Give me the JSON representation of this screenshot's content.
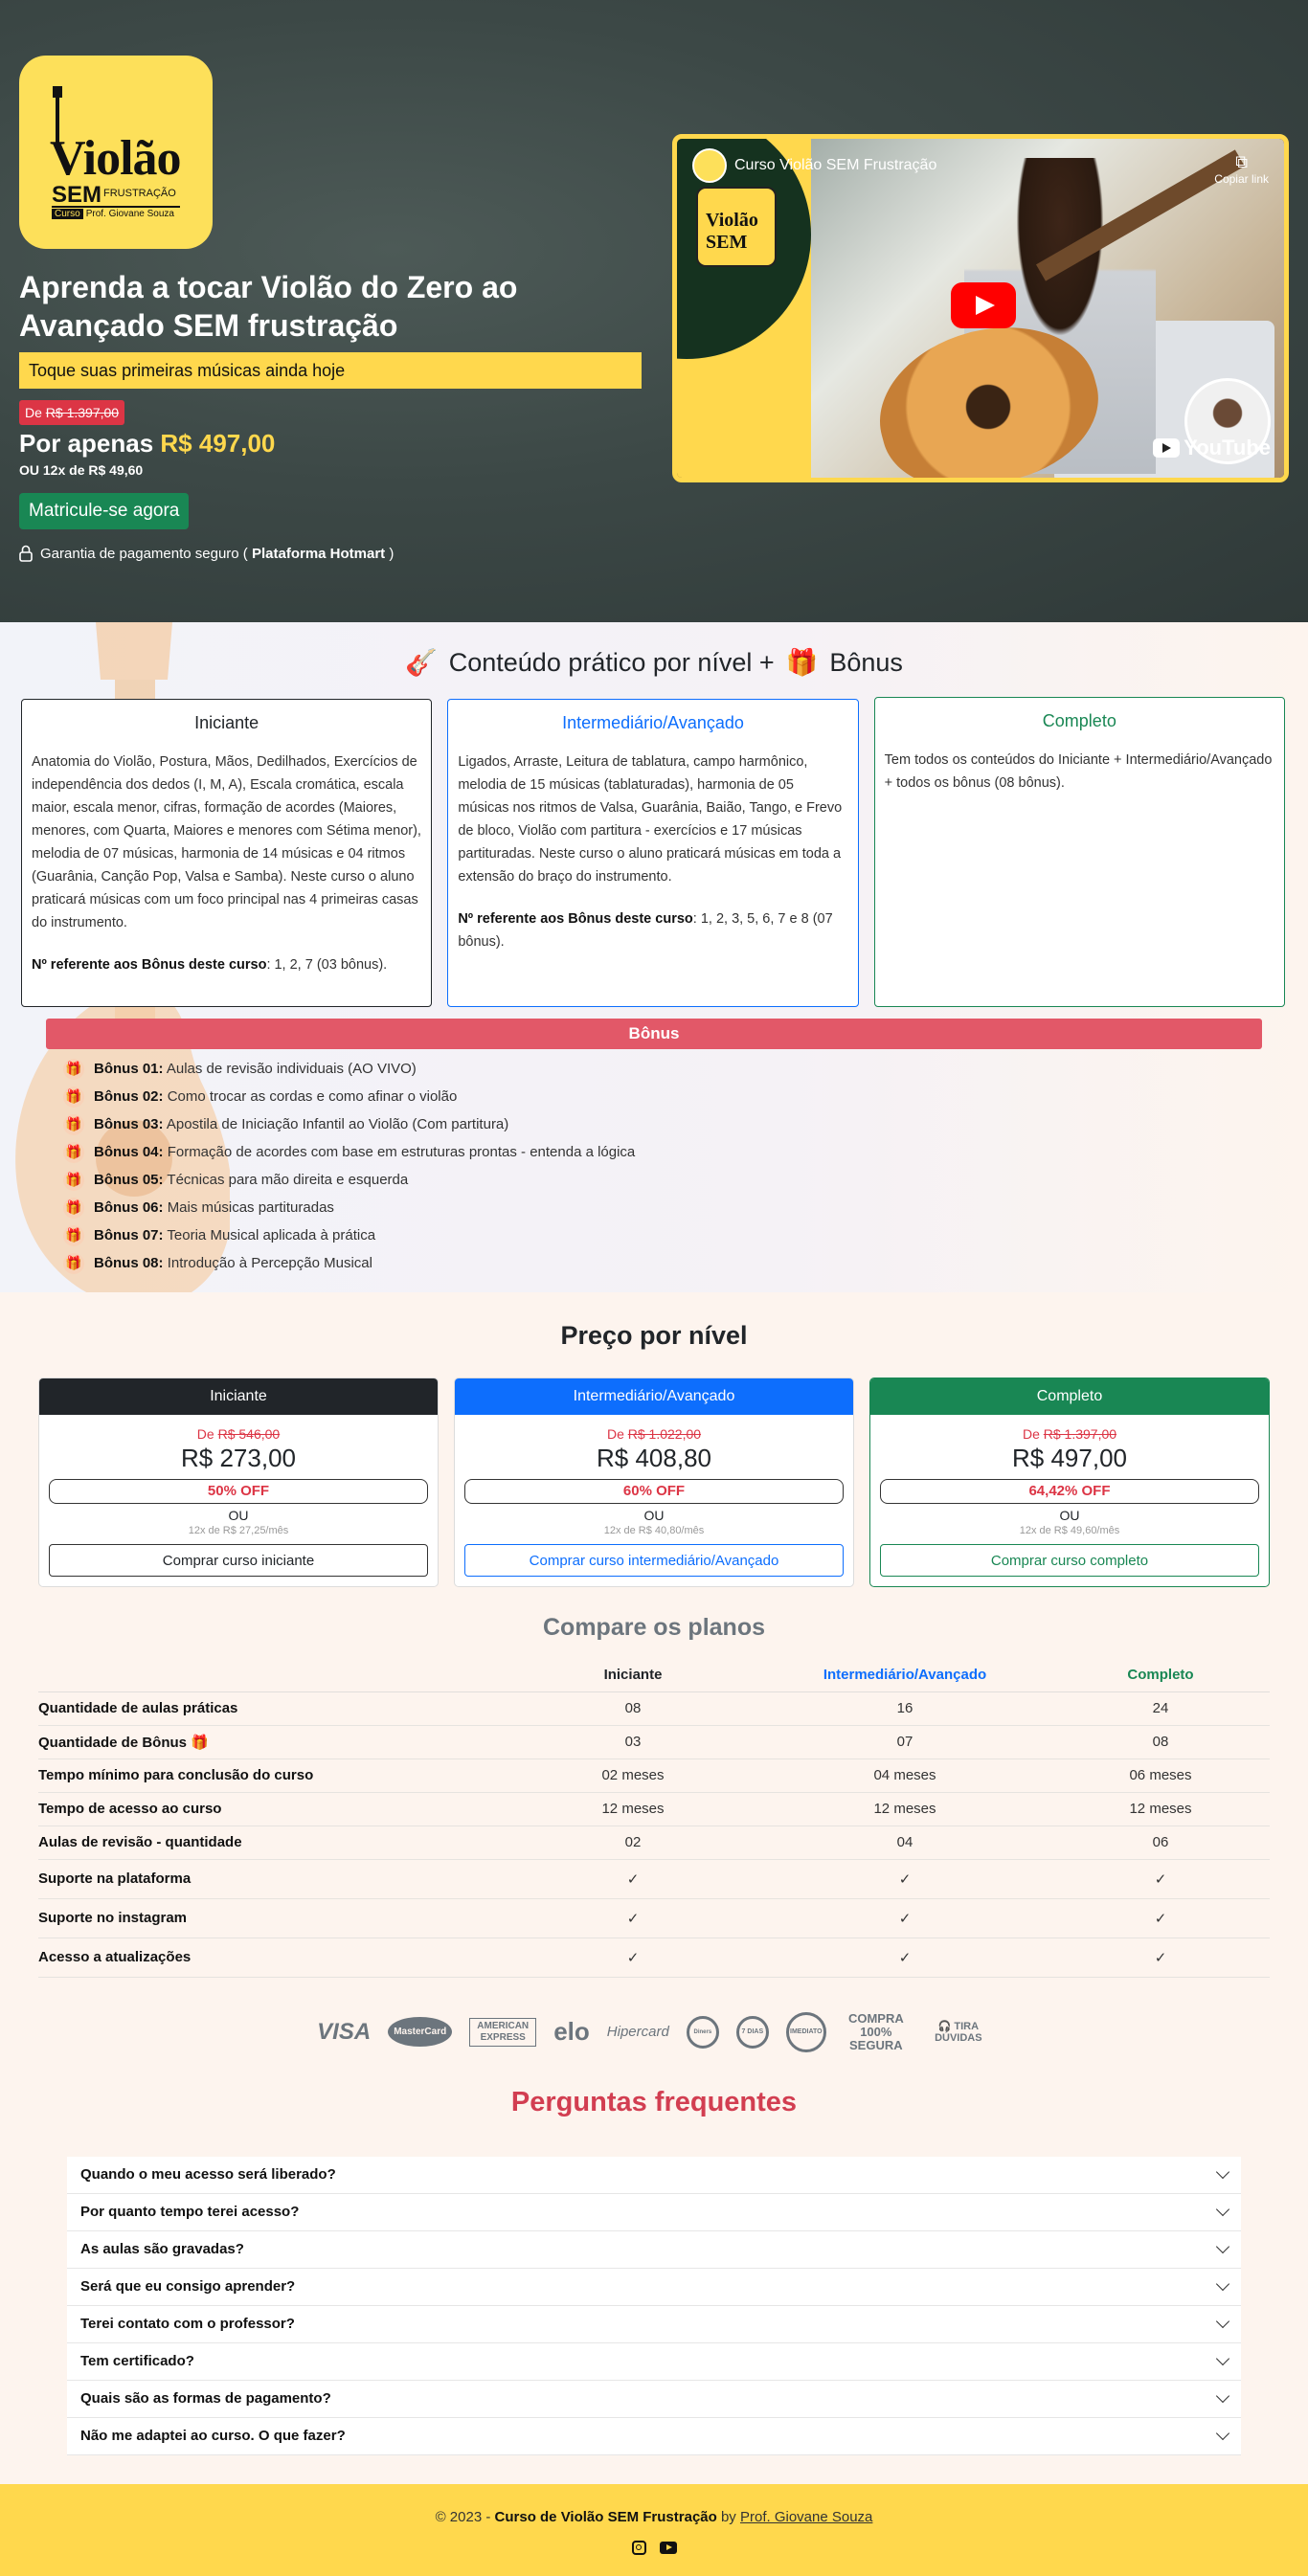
{
  "hero": {
    "logo": {
      "line1": "Violão",
      "line2": "SEM",
      "line3": "FRUSTRAÇÃO",
      "tag": "Curso",
      "author": "Prof. Giovane Souza"
    },
    "headline": "Aprenda a tocar Violão do Zero ao Avançado SEM frustração",
    "subline": "Toque suas primeiras músicas ainda hoje",
    "old_price_prefix": "De",
    "old_price": "R$ 1.397,00",
    "now_prefix": "Por apenas",
    "now_price": "R$ 497,00",
    "installments": "OU 12x de R$ 49,60",
    "enroll_label": "Matricule-se agora",
    "secure_text": "Garantia de pagamento seguro (",
    "secure_platform": "Plataforma Hotmart",
    "secure_end": ")",
    "video": {
      "title": "Curso Violão SEM Frustração",
      "copy_label": "Copiar link",
      "yt_label": "YouTube",
      "mini_logo": "Violão SEM"
    }
  },
  "content": {
    "title": "Conteúdo prático por nível +",
    "title_bonus": "Bônus",
    "levels": [
      {
        "name": "Iniciante",
        "desc": "Anatomia do Violão, Postura, Mãos, Dedilhados, Exercícios de independência dos dedos (I, M, A), Escala cromática, escala maior, escala menor, cifras, formação de acordes (Maiores, menores, com Quarta, Maiores e menores com Sétima menor), melodia de 07 músicas, harmonia de 14 músicas e 04 ritmos (Guarânia, Canção Pop, Valsa e Samba). Neste curso o aluno praticará músicas com um foco principal nas 4 primeiras casas do instrumento.",
        "bonus_label": "Nº referente aos Bônus deste curso",
        "bonus_text": ": 1, 2, 7 (03 bônus)."
      },
      {
        "name": "Intermediário/Avançado",
        "desc": "Ligados, Arraste, Leitura de tablatura, campo harmônico, melodia de 15 músicas (tablaturadas), harmonia de 05 músicas nos ritmos de Valsa, Guarânia, Baião, Tango, e Frevo de bloco, Violão com partitura - exercícios e 17 músicas partituradas. Neste curso o aluno praticará músicas em toda a extensão do braço do instrumento.",
        "bonus_label": "Nº referente aos Bônus deste curso",
        "bonus_text": ": 1, 2, 3, 5, 6, 7 e 8 (07 bônus)."
      },
      {
        "name": "Completo",
        "desc": "Tem todos os conteúdos do Iniciante + Intermediário/Avançado + todos os bônus (08 bônus).",
        "bonus_label": "",
        "bonus_text": ""
      }
    ],
    "bonus_header": "Bônus",
    "bonuses": [
      {
        "label": "Bônus 01:",
        "text": "Aulas de revisão individuais (AO VIVO)"
      },
      {
        "label": "Bônus 02:",
        "text": "Como trocar as cordas e como afinar o violão"
      },
      {
        "label": "Bônus 03:",
        "text": "Apostila de Iniciação Infantil ao Violão (Com partitura)"
      },
      {
        "label": "Bônus 04:",
        "text": "Formação de acordes com base em estruturas prontas - entenda a lógica"
      },
      {
        "label": "Bônus 05:",
        "text": "Técnicas para mão direita e esquerda"
      },
      {
        "label": "Bônus 06:",
        "text": "Mais músicas partituradas"
      },
      {
        "label": "Bônus 07:",
        "text": "Teoria Musical aplicada à prática"
      },
      {
        "label": "Bônus 08:",
        "text": "Introdução à Percepção Musical"
      }
    ]
  },
  "prices": {
    "title": "Preço por nível",
    "cards": [
      {
        "name": "Iniciante",
        "from_prefix": "De",
        "from": "R$ 546,00",
        "price": "R$ 273,00",
        "off": "50% OFF",
        "ou": "OU",
        "inst": "12x de R$ 27,25/mês",
        "buy": "Comprar curso iniciante"
      },
      {
        "name": "Intermediário/Avançado",
        "from_prefix": "De",
        "from": "R$ 1.022,00",
        "price": "R$ 408,80",
        "off": "60% OFF",
        "ou": "OU",
        "inst": "12x de R$ 40,80/mês",
        "buy": "Comprar curso intermediário/Avançado"
      },
      {
        "name": "Completo",
        "from_prefix": "De",
        "from": "R$ 1.397,00",
        "price": "R$ 497,00",
        "off": "64,42% OFF",
        "ou": "OU",
        "inst": "12x de R$ 49,60/mês",
        "buy": "Comprar curso completo"
      }
    ]
  },
  "compare": {
    "title": "Compare os planos",
    "cols": [
      "Iniciante",
      "Intermediário/Avançado",
      "Completo"
    ],
    "rows": [
      {
        "label": "Quantidade de aulas práticas",
        "v": [
          "08",
          "16",
          "24"
        ]
      },
      {
        "label": "Quantidade de Bônus",
        "v": [
          "03",
          "07",
          "08"
        ]
      },
      {
        "label": "Tempo mínimo para conclusão do curso",
        "v": [
          "02 meses",
          "04 meses",
          "06 meses"
        ]
      },
      {
        "label": "Tempo de acesso ao curso",
        "v": [
          "12 meses",
          "12 meses",
          "12 meses"
        ]
      },
      {
        "label": "Aulas de revisão - quantidade",
        "v": [
          "02",
          "04",
          "06"
        ]
      },
      {
        "label": "Suporte na plataforma",
        "v": [
          "✓",
          "✓",
          "✓"
        ]
      },
      {
        "label": "Suporte no instagram",
        "v": [
          "✓",
          "✓",
          "✓"
        ]
      },
      {
        "label": "Acesso a atualizações",
        "v": [
          "✓",
          "✓",
          "✓"
        ]
      }
    ]
  },
  "payments": [
    "VISA",
    "MasterCard",
    "AMERICAN EXPRESS",
    "elo",
    "Hipercard",
    "Diners",
    "7 DIAS",
    "IMEDIATO",
    "COMPRA 100% SEGURA",
    "TIRA DÚVIDAS"
  ],
  "faq": {
    "title": "Perguntas frequentes",
    "items": [
      "Quando o meu acesso será liberado?",
      "Por quanto tempo terei acesso?",
      "As aulas são gravadas?",
      "Será que eu consigo aprender?",
      "Terei contato com o professor?",
      "Tem certificado?",
      "Quais são as formas de pagamento?",
      "Não me adaptei ao curso. O que fazer?"
    ]
  },
  "footer": {
    "prefix": "© 2023 -",
    "course": "Curso de Violão SEM Frustração",
    "by": "by",
    "author": "Prof. Giovane Souza"
  },
  "colors": {
    "accent": "#ffd84d",
    "danger": "#dc3545",
    "success": "#198754",
    "primary": "#0d6efd"
  }
}
